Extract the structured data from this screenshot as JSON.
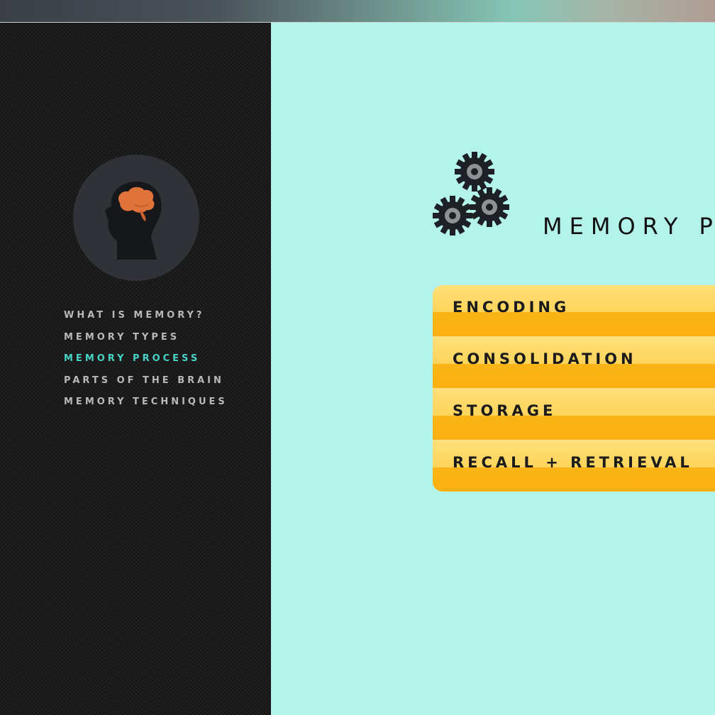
{
  "nav": {
    "items": [
      {
        "label": "WHAT IS MEMORY?"
      },
      {
        "label": "MEMORY TYPES"
      },
      {
        "label": "MEMORY PROCESS",
        "active": true
      },
      {
        "label": "PARTS OF THE BRAIN"
      },
      {
        "label": "MEMORY TECHNIQUES"
      }
    ]
  },
  "main": {
    "title": "MEMORY P",
    "steps": [
      {
        "label": "ENCODING"
      },
      {
        "label": "CONSOLIDATION"
      },
      {
        "label": "STORAGE"
      },
      {
        "label": "RECALL + RETRIEVAL"
      }
    ]
  },
  "icons": {
    "logo": "head-with-brain-icon",
    "section": "gears-icon"
  },
  "colors": {
    "sidebar_bg": "#1b1b1b",
    "main_bg": "#b4f3ea",
    "nav_text": "#b8b8b8",
    "nav_active": "#48d3c6",
    "brain": "#e0733a",
    "step_light": "#ffd45a",
    "step_dark": "#fbb516"
  }
}
